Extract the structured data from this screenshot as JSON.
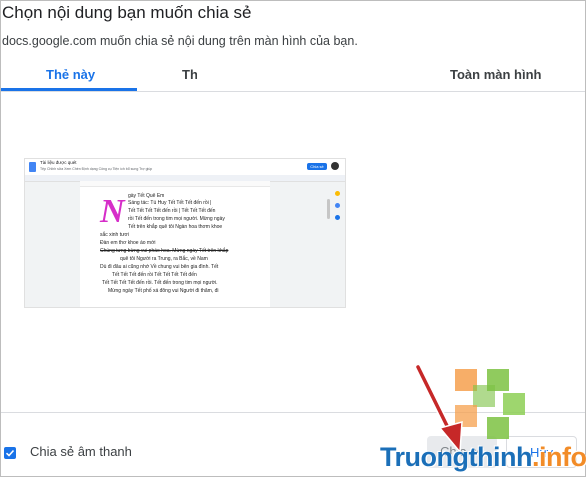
{
  "dialog": {
    "title": "Chọn nội dung bạn muốn chia sẻ",
    "subtitle": "docs.google.com muốn chia sẻ nội dung trên màn hình của bạn."
  },
  "tabs": [
    {
      "label": "Thẻ này",
      "active": true
    },
    {
      "label": "Th",
      "active": false
    },
    {
      "label": "Toàn màn hình",
      "active": false
    }
  ],
  "preview": {
    "doc_title": "Tài liệu được quét",
    "menu": "Tệp  Chỉnh sửa  Xem  Chèn  Định dạng  Công cụ  Tiện ích bổ sung  Trợ giúp",
    "share_label": "Chia sẻ",
    "lines": [
      "gày Tết Quê Em",
      "Sáng tác: Tú Huy Tết Tết Tết đến rồi |",
      "Tết Tết Tết Tết đến rồi | Tết Tết Tết đến",
      "rồi Tết đến trong tim mọi người. Mừng ngày",
      "Tết trên khắp quê tôi Ngàn hoa thơm khoe",
      "sắc xinh tươi",
      "Đàn em thơ khoe áo mới",
      "Chúng tưng bừng vui pháo hoa. Mừng ngày Tết trên khắp",
      "quê tôi Người ra Trung, ra Bắc, về Nam",
      "Dù đi đâu ai cũng nhớ Về chung vui bên gia đình. Tết",
      "Tết Tết Tết đến rồi Tết Tết Tết Tết đến",
      "Tết Tết Tết Tết đến rồi. Tết đến trong tim mọi người.",
      "Mừng ngày Tết phố xá đông vui Người đi thăm, đi"
    ]
  },
  "footer": {
    "audio_checkbox_checked": true,
    "audio_label": "Chia sẻ âm thanh",
    "share_button": "Chia sẻ",
    "cancel_button": "Hủy"
  },
  "watermark": {
    "text_main": "Truongthinh",
    "text_suffix": ".info"
  },
  "colors": {
    "accent": "#1a73e8",
    "arrow": "#c62828"
  }
}
